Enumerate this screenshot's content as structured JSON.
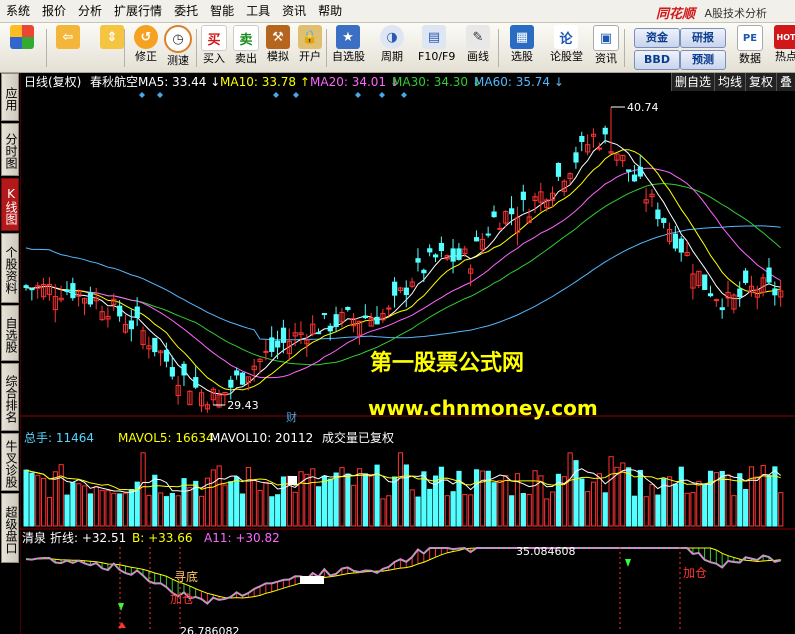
{
  "menu": [
    "系统",
    "报价",
    "分析",
    "扩展行情",
    "委托",
    "智能",
    "工具",
    "资讯",
    "帮助"
  ],
  "brand": {
    "name": "同花顺",
    "subtitle": "A股技术分析"
  },
  "toolbar": [
    {
      "icon": "app-grid-icon",
      "label": ""
    },
    {
      "icon": "back-arrow-icon",
      "label": ""
    },
    {
      "icon": "updown-arrows-icon",
      "label": ""
    },
    {
      "icon": "revise-icon",
      "label": "修正"
    },
    {
      "icon": "clock-icon",
      "label": "测速"
    },
    {
      "icon": "buy-icon",
      "label": "买入",
      "glyph": "买"
    },
    {
      "icon": "sell-icon",
      "label": "卖出",
      "glyph": "卖"
    },
    {
      "icon": "gavel-icon",
      "label": "模拟"
    },
    {
      "icon": "lock-icon",
      "label": "开户"
    },
    {
      "icon": "star-screen-icon",
      "label": "自选股"
    },
    {
      "icon": "period-icon",
      "label": "周期"
    },
    {
      "icon": "f10-icon",
      "label": "F10/F9"
    },
    {
      "icon": "pen-icon",
      "label": "画线"
    },
    {
      "icon": "screen-stock-icon",
      "label": "选股"
    },
    {
      "icon": "forum-icon",
      "label": "论股堂",
      "glyph": "论"
    },
    {
      "icon": "news-icon",
      "label": "资讯"
    },
    {
      "icon": "pe-icon",
      "label": "数据",
      "glyph": "PE"
    },
    {
      "icon": "hot-icon",
      "label": "热点"
    }
  ],
  "pill_buttons": [
    "资金",
    "研报",
    "BBD",
    "预测"
  ],
  "sidebar_tabs": [
    "应用",
    "分时图",
    "K线图",
    "个股资料",
    "自选股",
    "综合排名",
    "牛叉诊股",
    "超级盘口"
  ],
  "active_sidebar": "K线图",
  "chart_header": {
    "title": "日线(复权)",
    "stock": "春秋航空",
    "ma": [
      {
        "label": "MA5: 33.44",
        "color": "#ffffff",
        "arrow": "↓"
      },
      {
        "label": "MA10: 33.78",
        "color": "#ffff00",
        "arrow": "↑"
      },
      {
        "label": "MA20: 34.01",
        "color": "#ff66ff",
        "arrow": "↓"
      },
      {
        "label": "MA30: 34.30",
        "color": "#33cc33",
        "arrow": "↓"
      },
      {
        "label": "MA60: 35.74",
        "color": "#55b8ff",
        "arrow": "↓"
      }
    ],
    "right_buttons": [
      "删自选",
      "均线",
      "复权",
      "叠"
    ]
  },
  "price_labels": {
    "high": "40.74",
    "low": "29.43",
    "event": "财"
  },
  "watermark": {
    "line1": "第一股票公式网",
    "line2": "www.chnmoney.com"
  },
  "volume_header": {
    "total": "总手: 11464",
    "mavol5": "MAVOL5: 16634",
    "mavol10": "MAVOL10: 20112",
    "note": "成交量已复权"
  },
  "indicator_header": {
    "name": "清泉",
    "zhexian": "折线: +32.51",
    "b": "B: +33.66",
    "a11": "A11: +30.82"
  },
  "indicator_labels": {
    "xundi": "寻底",
    "jiacang1": "加仓",
    "jiacang2": "加仓",
    "value_top": "35.084608",
    "value_bottom": "26.786082"
  },
  "colors": {
    "up": "#ff3333",
    "down": "#54ffff",
    "ma5": "#ffffff",
    "ma10": "#ffff00",
    "ma20": "#ff66ff",
    "ma30": "#33cc33",
    "ma60": "#55b8ff",
    "watermark": "#ffff00"
  },
  "chart_data": {
    "type": "candlestick",
    "title": "春秋航空 日线(复权)",
    "candles_approx": {
      "count": 130,
      "high": 40.74,
      "low": 29.43
    },
    "ma_values": {
      "MA5": 33.44,
      "MA10": 33.78,
      "MA20": 34.01,
      "MA30": 34.3,
      "MA60": 35.74
    },
    "volume": {
      "last": 11464,
      "MAVOL5": 16634,
      "MAVOL10": 20112
    }
  }
}
